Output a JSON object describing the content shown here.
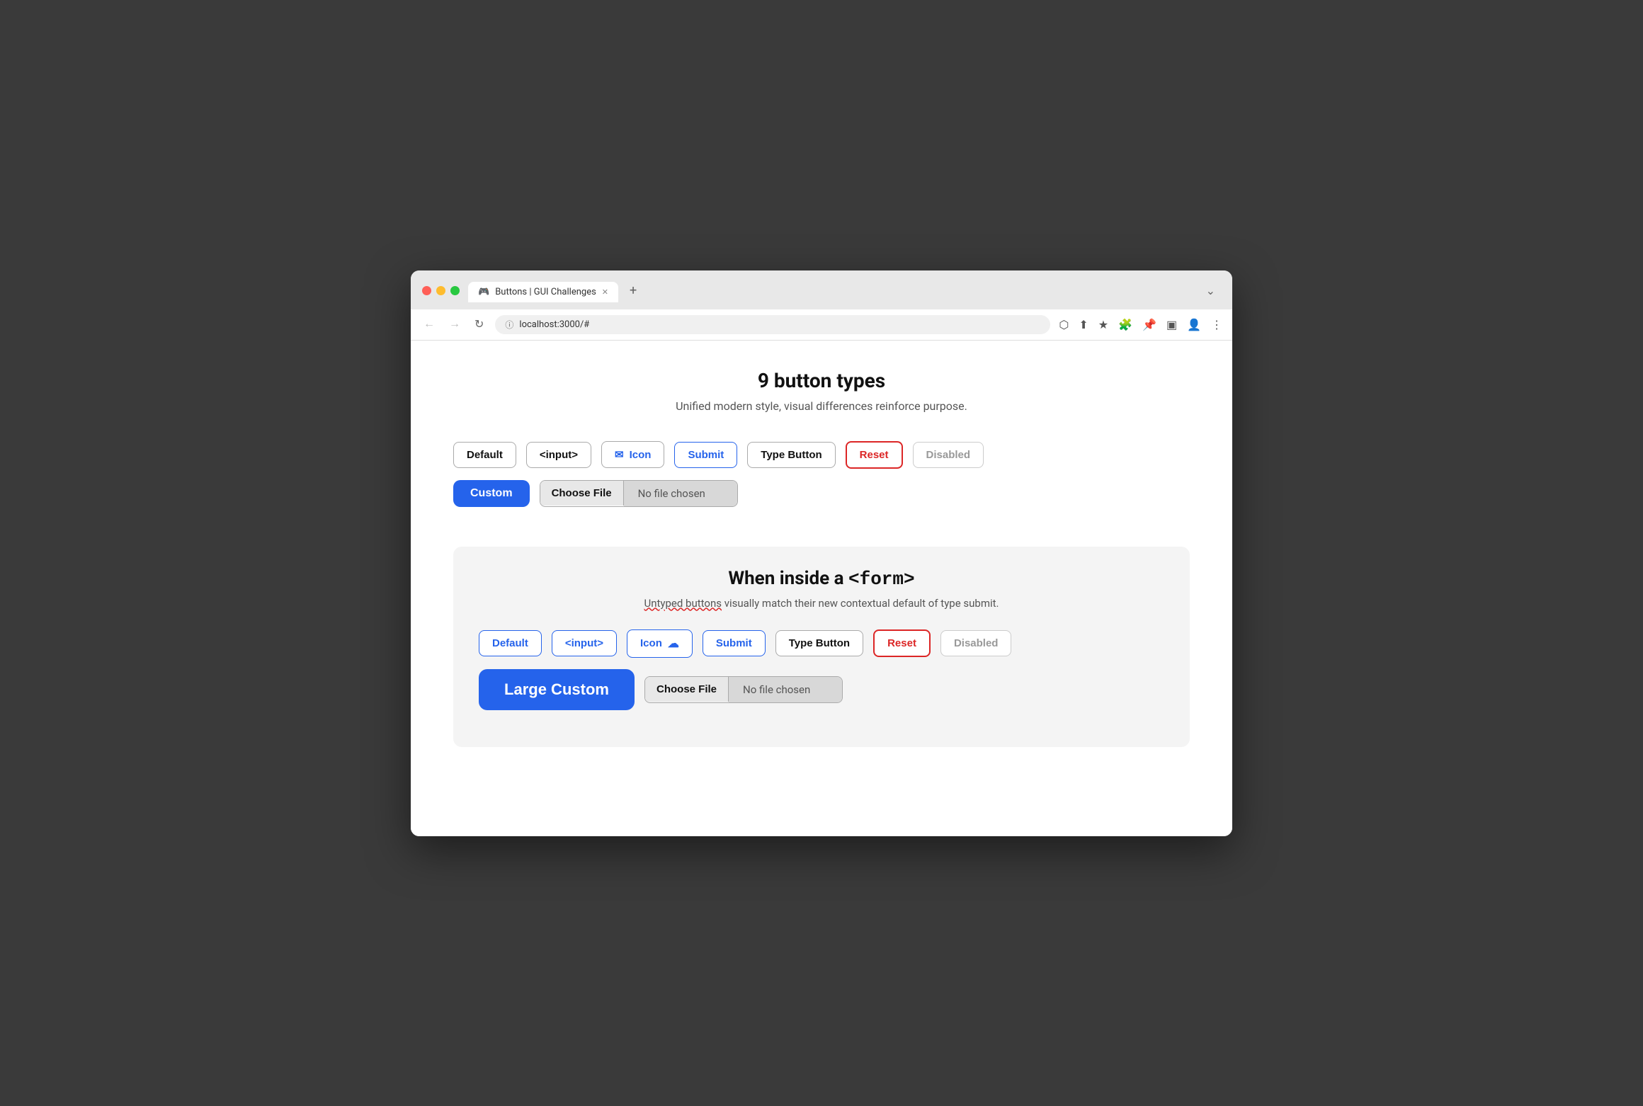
{
  "browser": {
    "url": "localhost:3000/#",
    "tab_title": "Buttons | GUI Challenges",
    "tab_icon": "🎮"
  },
  "page": {
    "title": "9 button types",
    "subtitle": "Unified modern style, visual differences reinforce purpose.",
    "top_row": {
      "buttons": [
        {
          "id": "default",
          "label": "Default",
          "type": "default"
        },
        {
          "id": "input",
          "label": "<input>",
          "type": "input"
        },
        {
          "id": "icon",
          "label": "Icon",
          "type": "icon",
          "icon": "✉"
        },
        {
          "id": "submit",
          "label": "Submit",
          "type": "submit"
        },
        {
          "id": "type-button",
          "label": "Type Button",
          "type": "type-button"
        },
        {
          "id": "reset",
          "label": "Reset",
          "type": "reset"
        },
        {
          "id": "disabled",
          "label": "Disabled",
          "type": "disabled"
        }
      ]
    },
    "bottom_row": {
      "custom_label": "Custom",
      "file_choose": "Choose File",
      "file_no_chosen": "No file chosen"
    },
    "form_section": {
      "title": "When inside a ",
      "title_code": "<form>",
      "subtitle_plain": " visually match their new contextual default of type submit.",
      "subtitle_underline": "Untyped buttons",
      "buttons": [
        {
          "id": "default-form",
          "label": "Default",
          "type": "default-form"
        },
        {
          "id": "input-form",
          "label": "<input>",
          "type": "input-form"
        },
        {
          "id": "icon-form",
          "label": "Icon",
          "type": "icon-form",
          "icon": "☁"
        },
        {
          "id": "submit-form",
          "label": "Submit",
          "type": "submit-form"
        },
        {
          "id": "type-button-form",
          "label": "Type Button",
          "type": "type-button-form"
        },
        {
          "id": "reset-form",
          "label": "Reset",
          "type": "reset-form"
        },
        {
          "id": "disabled-form",
          "label": "Disabled",
          "type": "disabled-form"
        }
      ],
      "large_custom_label": "Large Custom",
      "file_choose": "Choose File",
      "file_no_chosen": "No file chosen"
    }
  }
}
